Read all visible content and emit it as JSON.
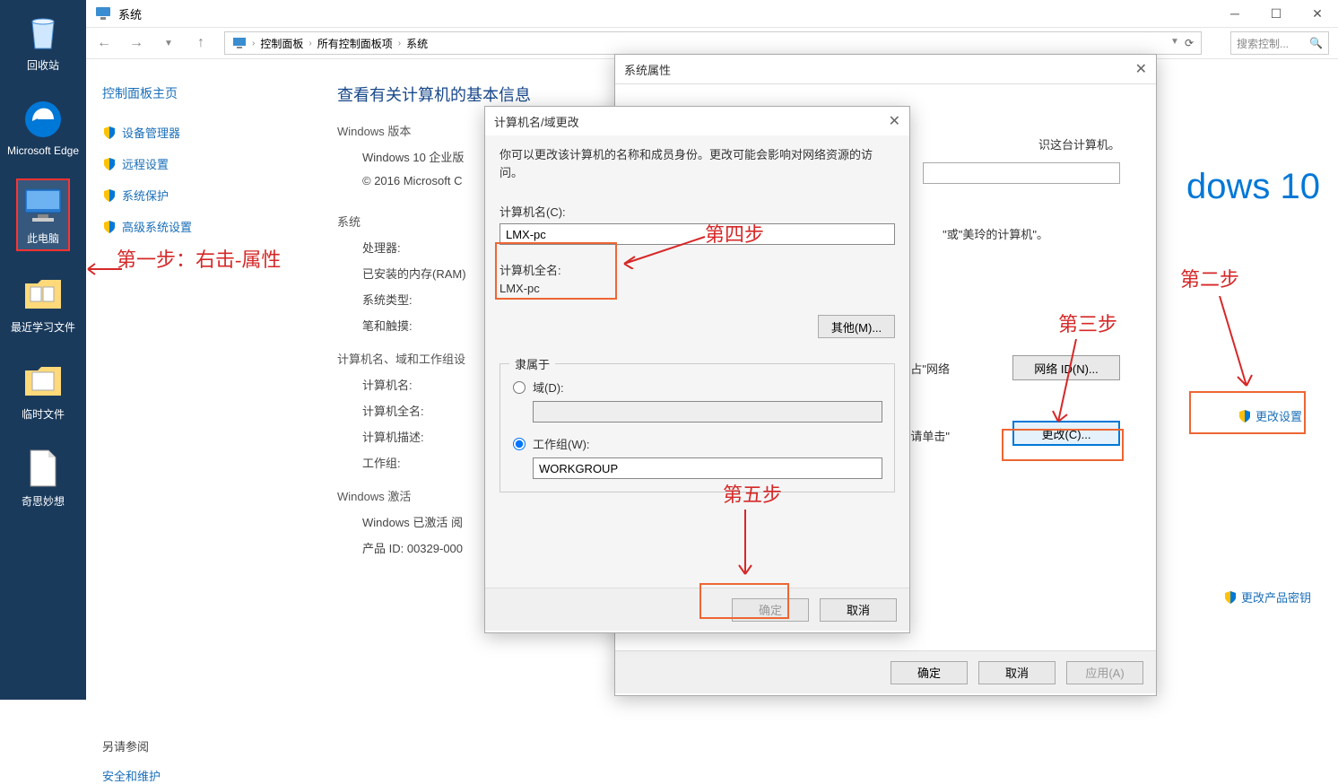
{
  "desktop": {
    "recycle": "回收站",
    "edge": "Microsoft Edge",
    "thispc": "此电脑",
    "recent": "最近学习文件",
    "temp": "临时文件",
    "ideas": "奇思妙想"
  },
  "window": {
    "title": "系统",
    "breadcrumb": [
      "控制面板",
      "所有控制面板项",
      "系统"
    ],
    "search_placeholder": "搜索控制..."
  },
  "sidebar": {
    "home": "控制面板主页",
    "links": [
      "设备管理器",
      "远程设置",
      "系统保护",
      "高级系统设置"
    ],
    "refs_title": "另请参阅",
    "refs_link": "安全和维护"
  },
  "content": {
    "heading": "查看有关计算机的基本信息",
    "win_version_head": "Windows 版本",
    "win_version": "Windows 10 企业版",
    "copyright": "© 2016 Microsoft C",
    "system_head": "系统",
    "rows": {
      "cpu": "处理器:",
      "ram": "已安装的内存(RAM)",
      "type": "系统类型:",
      "pen": "笔和触摸:"
    },
    "computer_head": "计算机名、域和工作组设",
    "computer_rows": {
      "name": "计算机名:",
      "fullname": "计算机全名:",
      "desc": "计算机描述:",
      "workgroup": "工作组:"
    },
    "activation_head": "Windows 激活",
    "activation_status": "Windows 已激活  阅",
    "product_id": "产品 ID: 00329-000",
    "win10_logo": "dows 10",
    "snippet_identify": "识这台计算机。",
    "snippet_or_example": "\"或\"美玲的计算机\"。",
    "snippet_network": "占\"网络",
    "snippet_click": "请单击\"",
    "change_settings": "更改设置",
    "change_product_key": "更改产品密钥",
    "network_id_btn": "网络 ID(N)...",
    "change_btn": "更改(C)..."
  },
  "sysprops": {
    "title": "系统属性",
    "ok": "确定",
    "cancel": "取消",
    "apply": "应用(A)"
  },
  "renamedlg": {
    "title": "计算机名/域更改",
    "desc": "你可以更改该计算机的名称和成员身份。更改可能会影响对网络资源的访问。",
    "name_label": "计算机名(C):",
    "name_value": "LMX-pc",
    "fullname_label": "计算机全名:",
    "fullname_value": "LMX-pc",
    "more_btn": "其他(M)...",
    "group_legend": "隶属于",
    "domain_label": "域(D):",
    "workgroup_label": "工作组(W):",
    "workgroup_value": "WORKGROUP",
    "ok": "确定",
    "cancel": "取消"
  },
  "annotations": {
    "step1": "第一步：右击-属性",
    "step2": "第二步",
    "step3": "第三步",
    "step4": "第四步",
    "step5": "第五步"
  }
}
